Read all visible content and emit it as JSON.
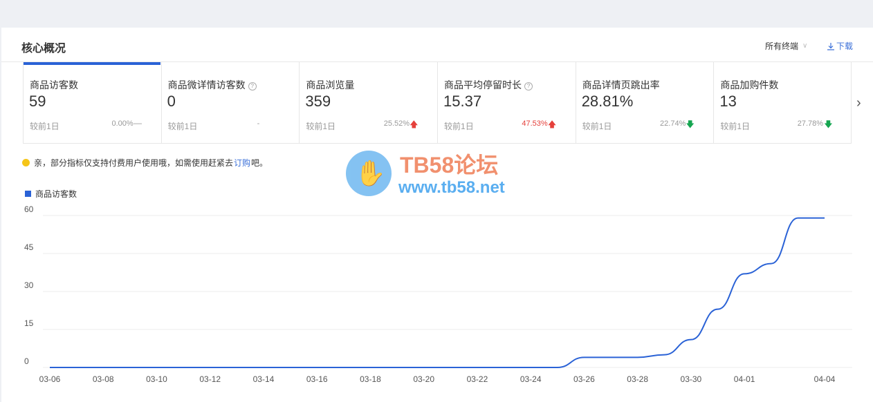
{
  "header": {
    "title": "核心概况",
    "terminal_label": "所有终端",
    "download_label": "下载"
  },
  "cards": [
    {
      "label": "商品访客数",
      "value": "59",
      "compare": "较前1日",
      "pct": "0.00%",
      "trend": "flat",
      "help": false,
      "active": true
    },
    {
      "label": "商品微详情访客数",
      "value": "0",
      "compare": "较前1日",
      "pct": "-",
      "trend": "none",
      "help": true,
      "active": false
    },
    {
      "label": "商品浏览量",
      "value": "359",
      "compare": "较前1日",
      "pct": "25.52%",
      "trend": "up",
      "help": false,
      "active": false
    },
    {
      "label": "商品平均停留时长",
      "value": "15.37",
      "compare": "较前1日",
      "pct": "47.53%",
      "trend": "up",
      "help": true,
      "active": false
    },
    {
      "label": "商品详情页跳出率",
      "value": "28.81%",
      "compare": "较前1日",
      "pct": "22.74%",
      "trend": "down",
      "help": false,
      "active": false
    },
    {
      "label": "商品加购件数",
      "value": "13",
      "compare": "较前1日",
      "pct": "27.78%",
      "trend": "down",
      "help": false,
      "active": false
    }
  ],
  "notice": {
    "before": "亲，部分指标仅支持付费用户使用哦，如需使用赶紧去",
    "link": "订购",
    "after": "吧。"
  },
  "watermark": {
    "title": "TB58论坛",
    "url": "www.tb58.net"
  },
  "colors": {
    "accent": "#2a62d6",
    "up": "#e5403b",
    "down": "#15a550",
    "notice_dot": "#f5c518"
  },
  "chart_data": {
    "type": "line",
    "series": [
      {
        "name": "商品访客数",
        "x": [
          "03-06",
          "03-07",
          "03-08",
          "03-09",
          "03-10",
          "03-11",
          "03-12",
          "03-13",
          "03-14",
          "03-15",
          "03-16",
          "03-17",
          "03-18",
          "03-19",
          "03-20",
          "03-21",
          "03-22",
          "03-23",
          "03-24",
          "03-25",
          "03-26",
          "03-27",
          "03-28",
          "03-29",
          "03-30",
          "03-31",
          "04-01",
          "04-02",
          "04-03",
          "04-04"
        ],
        "values": [
          0,
          0,
          0,
          0,
          0,
          0,
          0,
          0,
          0,
          0,
          0,
          0,
          0,
          0,
          0,
          0,
          0,
          0,
          0,
          0,
          4,
          4,
          4,
          5,
          11,
          23,
          37,
          41,
          59,
          59
        ]
      }
    ],
    "xticks": [
      "03-06",
      "03-08",
      "03-10",
      "03-12",
      "03-14",
      "03-16",
      "03-18",
      "03-20",
      "03-22",
      "03-24",
      "03-26",
      "03-28",
      "03-30",
      "04-01",
      "04-04"
    ],
    "yticks": [
      0,
      15,
      30,
      45,
      60
    ],
    "ylim": [
      0,
      60
    ],
    "grid": true
  }
}
